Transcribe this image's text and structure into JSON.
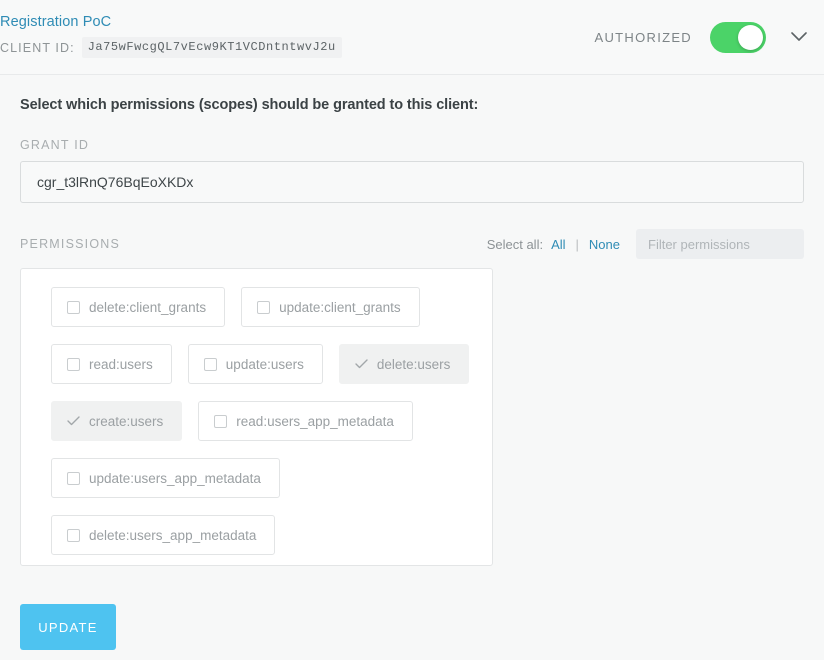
{
  "header": {
    "client_name": "Registration PoC",
    "client_id_label": "CLIENT ID:",
    "client_id_value": "Ja75wFwcgQL7vEcw9KT1VCDntntwvJ2u",
    "authorized_label": "AUTHORIZED",
    "authorized_state": "on",
    "chevron_icon": "chevron-down-icon",
    "toggle_color": "#4bd368"
  },
  "main": {
    "intro": "Select which permissions (scopes) should be granted to this client:",
    "grant_id_label": "GRANT ID",
    "grant_id_value": "cgr_t3lRnQ76BqEoXKDx",
    "permissions_label": "PERMISSIONS",
    "select_all_text": "Select all:",
    "select_all_link": "All",
    "select_none_link": "None",
    "pipe": "|",
    "filter_placeholder": "Filter permissions",
    "filter_value": ""
  },
  "permissions": {
    "rows": [
      [
        {
          "label": "delete:client_grants",
          "selected": false
        },
        {
          "label": "update:client_grants",
          "selected": false
        }
      ],
      [
        {
          "label": "read:users",
          "selected": false
        },
        {
          "label": "update:users",
          "selected": false
        },
        {
          "label": "delete:users",
          "selected": true
        }
      ],
      [
        {
          "label": "create:users",
          "selected": true
        },
        {
          "label": "read:users_app_metadata",
          "selected": false
        }
      ],
      [
        {
          "label": "update:users_app_metadata",
          "selected": false
        }
      ],
      [
        {
          "label": "delete:users_app_metadata",
          "selected": false
        }
      ],
      [
        {
          "label": "",
          "selected": false
        },
        {
          "label": "",
          "selected": false
        }
      ]
    ]
  },
  "footer": {
    "update_label": "UPDATE",
    "update_color": "#4ec3f0"
  }
}
